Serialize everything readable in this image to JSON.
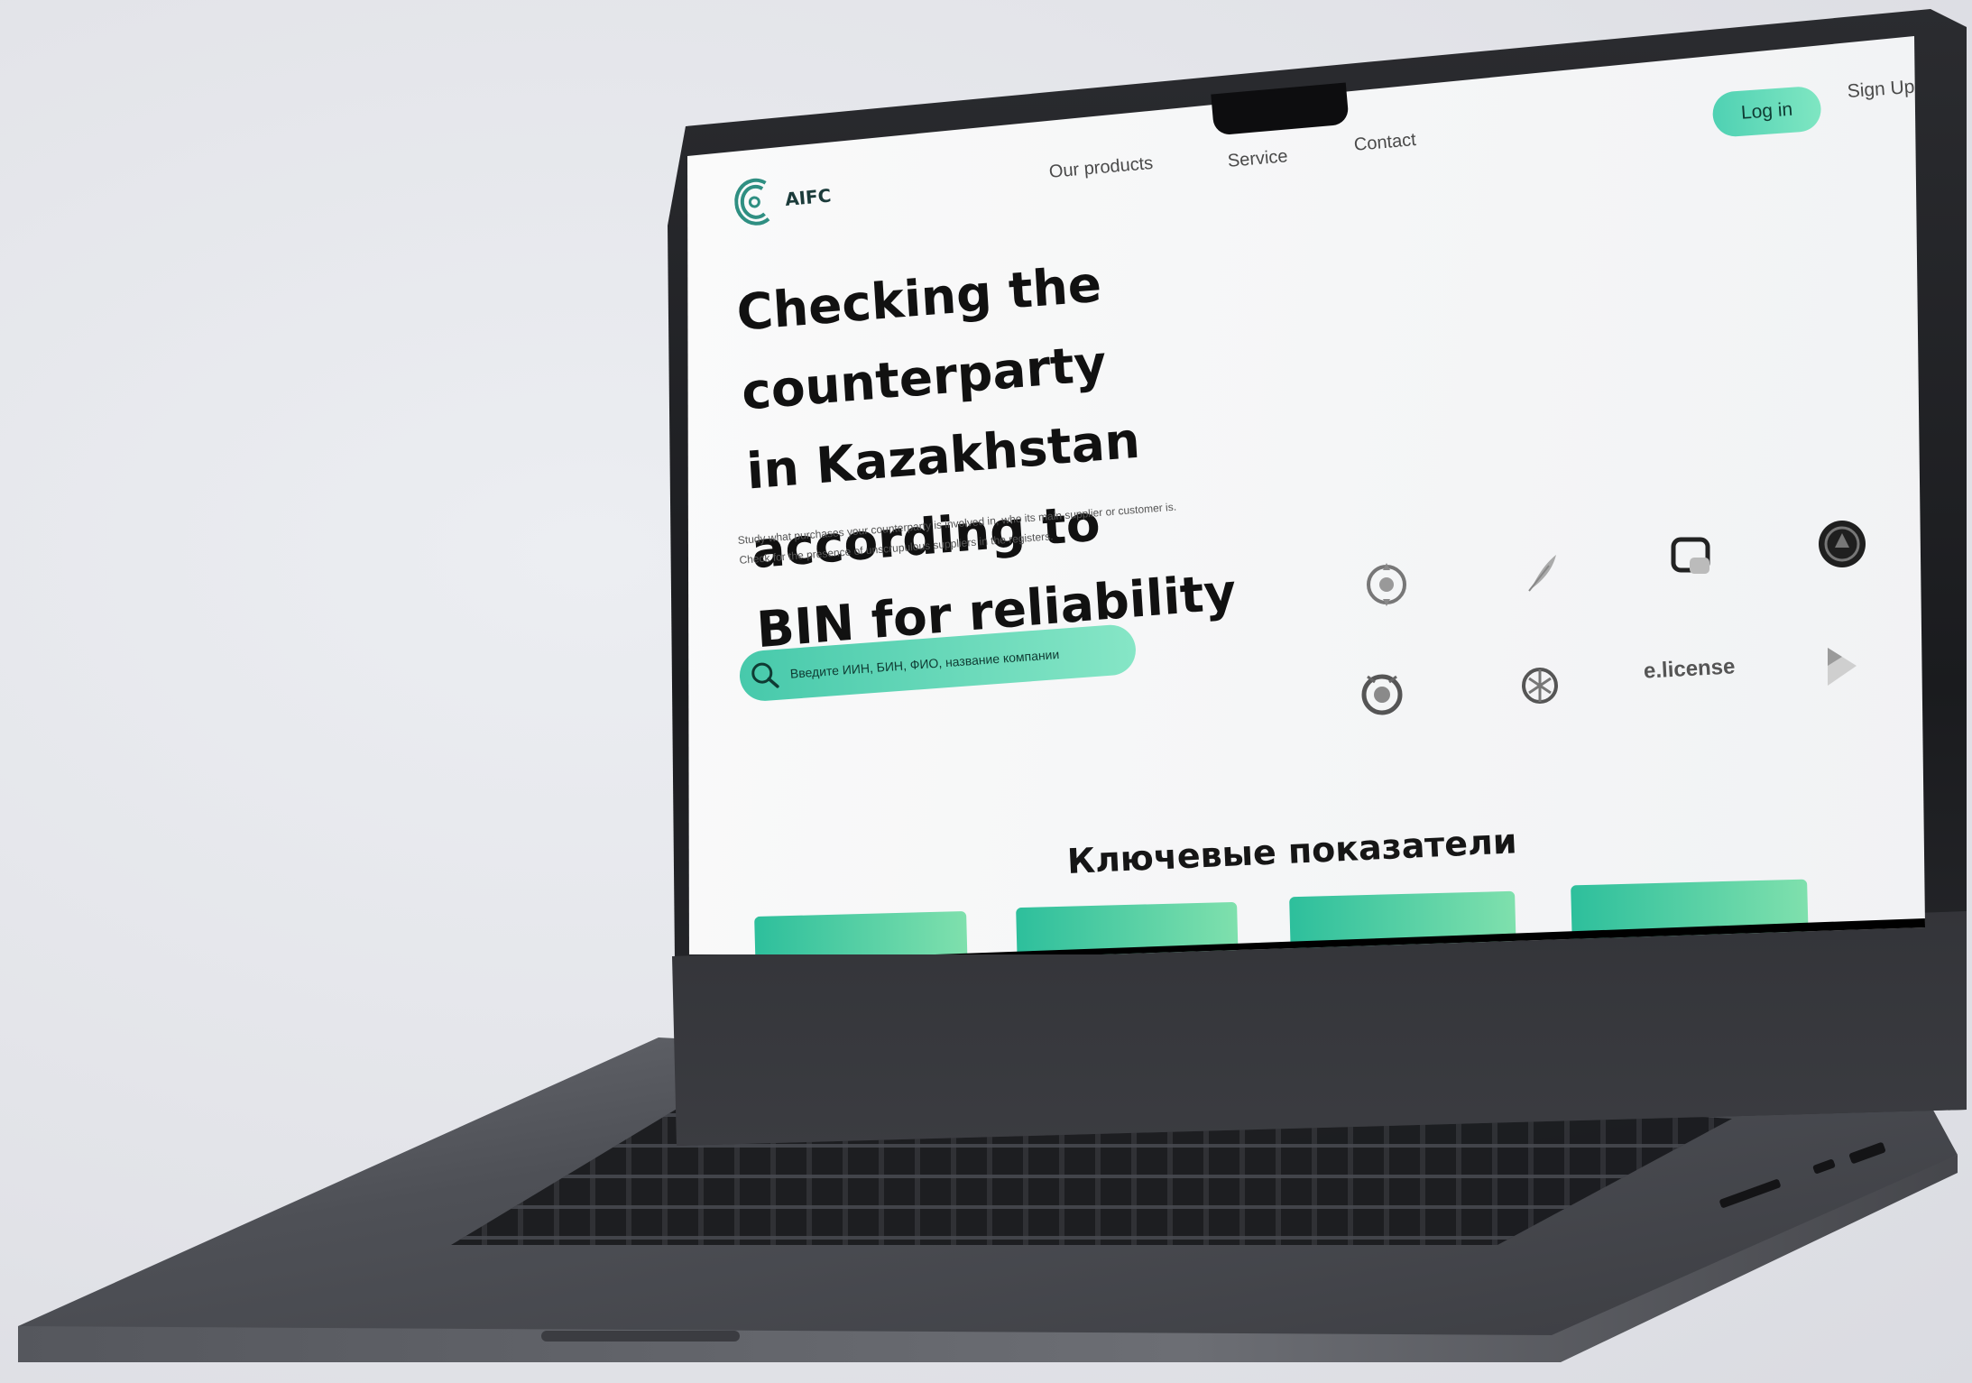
{
  "header": {
    "logo_text": "AIFC",
    "nav": [
      {
        "label": "Our products"
      },
      {
        "label": "Service"
      },
      {
        "label": "Contact"
      }
    ],
    "login_label": "Log in",
    "signup_label": "Sign Up"
  },
  "hero": {
    "title_lines": [
      "Checking the counterparty",
      "in Kazakhstan according to",
      "BIN for reliability"
    ],
    "subtitle_lines": [
      "Study what purchases your counterparty is involved in, who its main supplier or customer is.",
      "Check for the presence of unscrupulous suppliers in the registers."
    ],
    "search_placeholder": "Введите ИИН, БИН, ФИО, название компании"
  },
  "partners": {
    "license_label": "e.license",
    "icons": [
      "emblem-icon",
      "feather-icon",
      "chat-bubble-icon",
      "seal-icon",
      "emblem-icon",
      "emblem-icon",
      "play-icon"
    ]
  },
  "kpi": {
    "title": "Ключевые показатели",
    "cards": 4
  },
  "colors": {
    "accent": "#4fd1b3",
    "accent_light": "#7fe6c2",
    "brand_dark": "#1b3b3a"
  }
}
